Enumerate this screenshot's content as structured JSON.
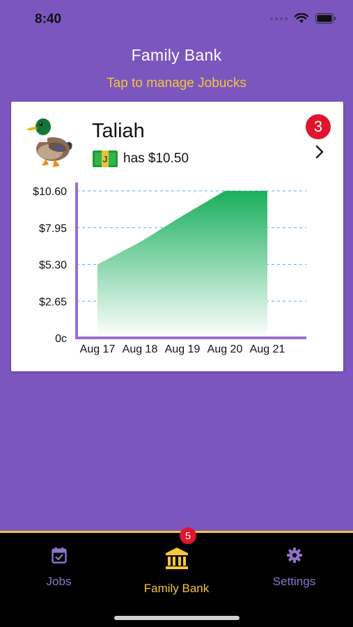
{
  "status_bar": {
    "time": "8:40"
  },
  "header": {
    "title": "Family Bank",
    "subtitle": "Tap to manage Jobucks"
  },
  "member": {
    "name": "Taliah",
    "avatar_icon": "duck-icon",
    "balance_icon": "money-bill-icon",
    "balance_text": "has $10.50",
    "notification_count": "3"
  },
  "chart_data": {
    "type": "area",
    "x": [
      "Aug 17",
      "Aug 18",
      "Aug 19",
      "Aug 20",
      "Aug 21"
    ],
    "series": [
      {
        "values": [
          5.3,
          6.9,
          8.8,
          10.6,
          10.6
        ]
      }
    ],
    "y_ticks": [
      "$10.60",
      "$7.95",
      "$5.30",
      "$2.65",
      "0c"
    ],
    "y_tick_values": [
      10.6,
      7.95,
      5.3,
      2.65,
      0
    ],
    "ylim": [
      0,
      10.6
    ],
    "grid": "horizontal dashed",
    "colors": {
      "fill_top": "#1aaf5d",
      "fill_bottom": "#ffffff",
      "axis": "#9a6fd0",
      "grid": "#4fb4e6"
    }
  },
  "tabbar": {
    "tabs": [
      {
        "label": "Jobs",
        "icon": "calendar-check-icon"
      },
      {
        "label": "Family Bank",
        "icon": "bank-icon",
        "badge": "5"
      },
      {
        "label": "Settings",
        "icon": "gear-icon"
      }
    ]
  },
  "colors": {
    "background": "#7a56be",
    "accent": "#f5c53a",
    "badge": "#e0142d",
    "tabbar": "#000000"
  }
}
